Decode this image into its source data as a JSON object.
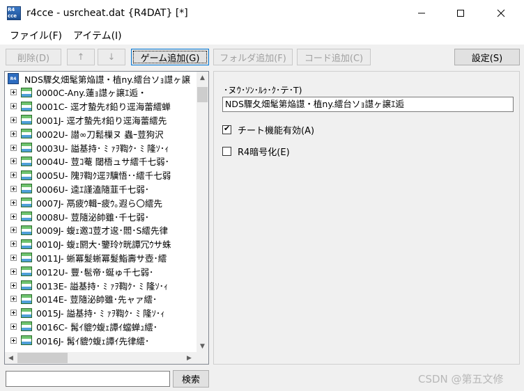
{
  "window": {
    "title": "r4cce - usrcheat.dat {R4DAT} [*]",
    "icon_text": "R4 cce"
  },
  "menu": {
    "items": [
      "ファイル(F)",
      "アイテム(I)"
    ]
  },
  "toolbar": {
    "delete": "削除(D)",
    "up": "↑",
    "down": "↓",
    "add_game": "ゲーム追加(G)",
    "add_folder": "フォルダ追加(F)",
    "add_code": "コード追加(C)",
    "settings": "設定(S)"
  },
  "tree": {
    "root_icon_text": "R4",
    "root_label": "NDS驟夂畑髦第焔譿・植ny.繧台ソｮ譿ヶ譲",
    "items": [
      "0000C-Any.蓮ｮ譿ヶ譲ｴ逅・",
      "0001C- 逕才蟄先ｵ鉛り逕海蕾繧蝉",
      "0001J- 逕才蟄先ｵ鉛り逕海蕾繧先",
      "0002U- 譛∞刀鬆樔ヌ 蟲ｰ荳狗沢",
      "0003U- 謚基持･ ﾐ ｧｦ鞫ｸ･ ﾐ 隆ｿ･ｨ",
      "0004U- 荳ｺ菴 閾梧ュサ繧千七弱･",
      "0005U- 隗ｦ鞫ｸ逕ｦ驥悟･･繧千七弱",
      "0006U- 逵ｴ謹溘隨韮千七弱･",
      "0007J- 鬲疲ｳ輯ｰ疲ｳ｡遐ら〇繧先",
      "0008U- 荳隨泌帥雖･千七弱･",
      "0009J- 蝮ｪ邀ｺ荳才逡･閻･S繧先律",
      "0010J- 蝮ｪ閼大･鑒玲ｹ晄譚冗ｳサ蛛",
      "0011J- 蜥冪髮蜥冪髮鮨壽サ壺･繧",
      "0012U- 豐･髢帝･蜒ゅ千七弱･",
      "0013E- 謚基持･ ﾐ ｧｦ鞫ｸ･ ﾐ 隆ｿ･ｨ",
      "0014E- 荳隨泌帥雖･先ャァ繧･",
      "0015J- 謚基持･ ﾐ ｧｦ鞫ｸ･ ﾐ 隆ｿ･ｨ",
      "0016C- 髯ｲ貔ｳ蝮ｪ譚ｲ蟷蝉ｭ繧･",
      "0016J- 髯ｲ貔ｳ蝮ｪ譚ｲ先律繧･"
    ]
  },
  "search": {
    "value": "",
    "button": "検索"
  },
  "detail": {
    "name_label": "･ヌｳ･ｿﾝ･ﾙｩ･ｸ･テ･T)",
    "name_value": "NDS驟夂畑髦第焔譿・植ny.繧台ソｮ譿ヶ譲ｴ逅",
    "cheat_enabled_label": "チート機能有効(A)",
    "cheat_enabled": true,
    "r4_encrypt_label": "R4暗号化(E)",
    "r4_encrypt": false
  },
  "watermark": "CSDN @第五文修",
  "colors": {
    "focus_border": "#0078d7",
    "disabled_text": "#a0a0a0",
    "icon_blue": "#2d6cc0",
    "icon_green": "#6fc36f"
  }
}
